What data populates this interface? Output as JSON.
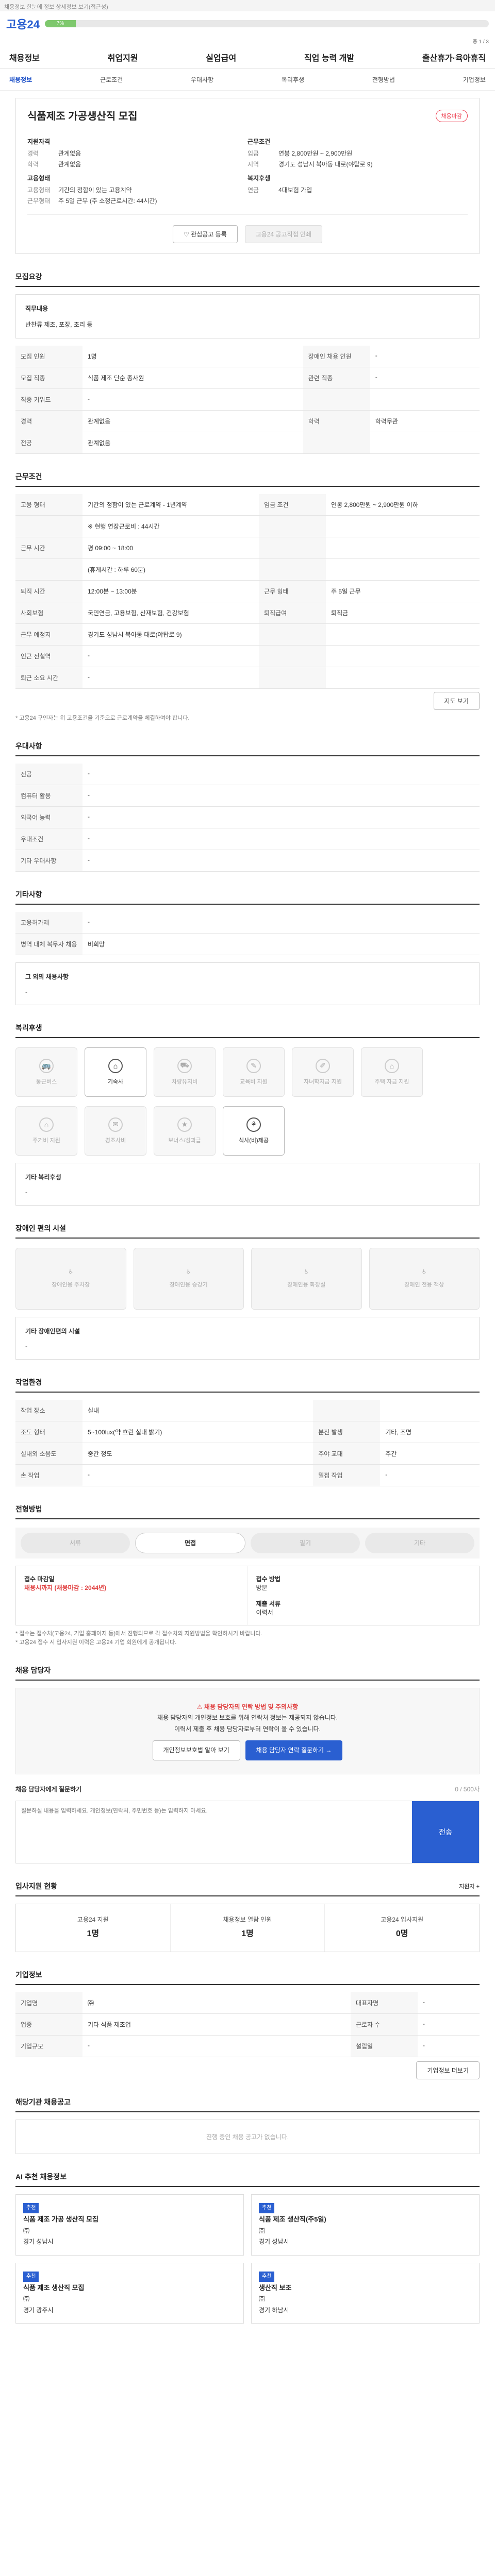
{
  "top": {
    "notice": "채용정보 한눈에 정보 상세정보 보기(접근성)"
  },
  "logo": "고용24",
  "progress": {
    "label": "7%",
    "fraction": 0.07,
    "count": "총 1 / 3"
  },
  "gnb": [
    "채용정보",
    "취업지원",
    "실업급여",
    "직업 능력 개발",
    "출산휴가·육아휴직"
  ],
  "subnav": [
    "채용정보",
    "근로조건",
    "우대사항",
    "복리후생",
    "전형방법",
    "기업정보"
  ],
  "job": {
    "title": "식품제조 가공생산직 모집",
    "badge": "채용마감",
    "company_h": "기업정보",
    "company_kv": [
      {
        "k": "기업명",
        "v": "㈜"
      },
      {
        "k": "업종",
        "v": "한국",
        "v2": ""
      }
    ],
    "left_h": "지원자격",
    "left_kv": [
      {
        "k": "경력",
        "v": "관계없음"
      },
      {
        "k": "학력",
        "v": "관계없음"
      }
    ],
    "right_h": "근무조건",
    "right_kv": [
      {
        "k": "임금",
        "v": "연봉 2,800만원 ~ 2,900만원"
      },
      {
        "k": "지역",
        "v": "경기도 성남시 북아동 대로(야탑로 9)"
      }
    ],
    "emp_h": "고용형태",
    "emp_kv": [
      {
        "k": "고용형태",
        "v": "기간의 정함이 있는 고용계약"
      },
      {
        "k": "근무형태",
        "v": "주 5일 근무 (주 소정근로시간: 44시간)"
      }
    ],
    "welfare_h": "복지후생",
    "welfare_kv": [
      {
        "k": "연금",
        "v": "4대보험 가입"
      }
    ],
    "btn1": "관심공고 등록",
    "btn2": "고용24 공고직접 인쇄"
  },
  "duty": {
    "title": "모집요강",
    "summary_h": "직무내용",
    "summary": "반찬류 제조, 포장, 조리 등",
    "rows": [
      [
        "모집 인원",
        "1명",
        "장애인 채용 인원",
        "-"
      ],
      [
        "모집 직종",
        "식품 제조 단순 종사원",
        "관련 직종",
        "-"
      ],
      [
        "직종 키워드",
        "-",
        "",
        ""
      ],
      [
        "경력",
        "관계없음",
        "학력",
        "학력무관"
      ],
      [
        "전공",
        "관계없음",
        "",
        ""
      ]
    ]
  },
  "cond": {
    "title": "근무조건",
    "rows": [
      [
        "고용 형태",
        "기간의 정함이 있는 근로계약 - 1년계약",
        "임금 조건",
        "연봉 2,800만원 ~ 2,900만원 이하"
      ],
      [
        "",
        "※ 현행 연장근로비 : 44시간",
        "",
        ""
      ],
      [
        "근무 시간",
        "평 09:00 ~ 18:00",
        "",
        ""
      ],
      [
        "",
        "(휴게시간 : 하루 60분)",
        "",
        ""
      ],
      [
        "퇴직 시간",
        "12:00분 ~ 13:00분",
        "근무 형태",
        "주 5일 근무"
      ],
      [
        "사회보험",
        "국민연금, 고용보험, 산재보험, 건강보험",
        "퇴직급여",
        "퇴직금"
      ],
      [
        "근무 예정지",
        "경기도 성남시 북아동 대로(야탑로 9)",
        "",
        ""
      ],
      [
        "인근 전철역",
        "-",
        "",
        ""
      ],
      [
        "퇴근 소요 시간",
        "-",
        "",
        ""
      ]
    ],
    "map_btn": "지도 보기",
    "note": "* 고용24 구인자는 위 고용조건을 기준으로 근로계약을 체결하여야 합니다."
  },
  "pref": {
    "title": "우대사항",
    "rows": [
      [
        "전공",
        "-"
      ],
      [
        "컴퓨터 활용",
        "-"
      ],
      [
        "외국어 능력",
        "-"
      ],
      [
        "우대조건",
        "-"
      ],
      [
        "기타 우대사항",
        "-"
      ]
    ]
  },
  "other": {
    "title": "기타사항",
    "rows": [
      [
        "고용허가제",
        "-"
      ],
      [
        "병역 대체 복무자 채용",
        "비희망"
      ]
    ],
    "h": "그 외의 채용사항",
    "v": "-"
  },
  "welfare": {
    "title": "복리후생",
    "items": [
      {
        "label": "통근버스",
        "on": false
      },
      {
        "label": "기숙사",
        "on": true
      },
      {
        "label": "차량유지비",
        "on": false
      },
      {
        "label": "교육비 지원",
        "on": false
      },
      {
        "label": "자녀학자금 지원",
        "on": false
      },
      {
        "label": "주택 자금 지원",
        "on": false
      },
      {
        "label": "주거비 지원",
        "on": false
      },
      {
        "label": "경조사비",
        "on": false
      },
      {
        "label": "보너스/성과급",
        "on": false
      },
      {
        "label": "식사(비)제공",
        "on": true
      }
    ],
    "etc_h": "기타 복리후생",
    "etc_v": "-"
  },
  "disab": {
    "title": "장애인 편의 시설",
    "items": [
      "장애인용 주차장",
      "장애인용 승강기",
      "장애인용 화장실",
      "장애인 전용 책상"
    ],
    "etc_h": "기타 장애인편의 시설",
    "etc_v": "-"
  },
  "workenv": {
    "title": "작업환경",
    "rows": [
      [
        "작업 장소",
        "실내",
        "",
        ""
      ],
      [
        "조도 형태",
        "5~100lux(약 흐린 실내 밝기)",
        "분진 발생",
        "기타, 조명"
      ],
      [
        "실내외 소음도",
        "중간 정도",
        "주야 교대",
        "주간"
      ],
      [
        "손 작업",
        "-",
        "밀접 작업",
        "-"
      ]
    ]
  },
  "process": {
    "title": "전형방법",
    "steps": [
      "서류",
      "면접",
      "필기",
      "기타"
    ],
    "active": 1,
    "apply_h": "접수 마감일",
    "apply_v": "채용시까지 (채용마감 : 2044년)",
    "method_h": "접수 방법",
    "method_v": "방문",
    "doc_h": "제출 서류",
    "doc_v": "이력서",
    "notes": [
      "* 접수는 접수처(고용24, 기업 홈페이지 등)에서 진행되므로 각 접수처의 지원방법을 확인하시기 바랍니다.",
      "* 고용24 접수 시 입사지원 이력은 고용24 기업 회원에게 공개됩니다."
    ]
  },
  "contact": {
    "title": "채용 담당자",
    "notice": "채용 담당자의 연락 방법 및 주의사항",
    "line1": "채용 담당자의 개인정보 보호를 위해 연락처 정보는 제공되지 않습니다.",
    "line2": "이력서 제출 후 채용 담당자로부터 연락이 올 수 있습니다.",
    "btn1": "개인정보보호법 알아 보기",
    "btn2": "채용 담당자 연락 질문하기 →",
    "q_h": "채용 담당자에게 질문하기",
    "q_count": "0 / 500자",
    "q_placeholder": "질문하실 내용을 입력하세요. 개인정보(연락처, 주민번호 등)는 입력하지 마세요.",
    "q_submit": "전송"
  },
  "apply_stats": {
    "title": "입사지원 현황",
    "more": "지원자 +",
    "items": [
      {
        "label": "고용24 지원",
        "value": "1명"
      },
      {
        "label": "채용정보 열람 인원",
        "value": "1명"
      },
      {
        "label": "고용24 입사지원",
        "value": "0명"
      }
    ]
  },
  "info": {
    "title": "기업정보",
    "rows": [
      [
        "기업명",
        "㈜",
        "대표자명",
        "-"
      ],
      [
        "업종",
        "기타 식품 제조업",
        "근로자 수",
        "-"
      ],
      [
        "기업규모",
        "-",
        "설립일",
        "-"
      ]
    ],
    "btn": "기업정보 더보기"
  },
  "related": {
    "title": "해당기관 채용공고",
    "empty": "진행 중인 채용 공고가 없습니다."
  },
  "rec": {
    "title": "AI 추천 채용정보",
    "cards": [
      {
        "tag": "추천",
        "title": "식품 제조 가공 생산직 모집",
        "co": "㈜",
        "loc": "경기 성남시"
      },
      {
        "tag": "추천",
        "title": "식품 제조 생산직(주5일)",
        "co": "㈜",
        "loc": "경기 성남시"
      },
      {
        "tag": "추천",
        "title": "식품 제조 생산직 모집",
        "co": "㈜",
        "loc": "경기 광주시"
      },
      {
        "tag": "추천",
        "title": "생산직 보조",
        "co": "㈜",
        "loc": "경기 하남시"
      }
    ]
  }
}
